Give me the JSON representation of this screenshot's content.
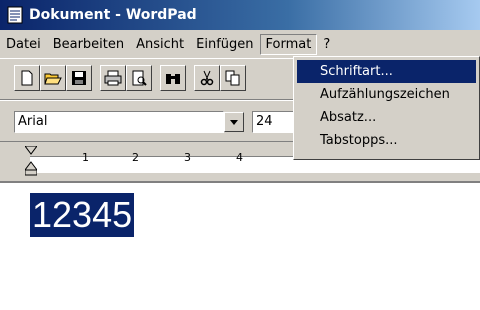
{
  "window": {
    "title": "Dokument - WordPad"
  },
  "menubar": {
    "items": [
      "Datei",
      "Bearbeiten",
      "Ansicht",
      "Einfügen",
      "Format",
      "?"
    ]
  },
  "format_toolbar": {
    "font": "Arial",
    "size": "24"
  },
  "ruler": {
    "numbers": [
      "1",
      "2",
      "3",
      "4"
    ]
  },
  "document": {
    "text": "12345"
  },
  "format_menu": {
    "items": [
      "Schriftart...",
      "Aufzählungszeichen",
      "Absatz...",
      "Tabstopps..."
    ]
  }
}
